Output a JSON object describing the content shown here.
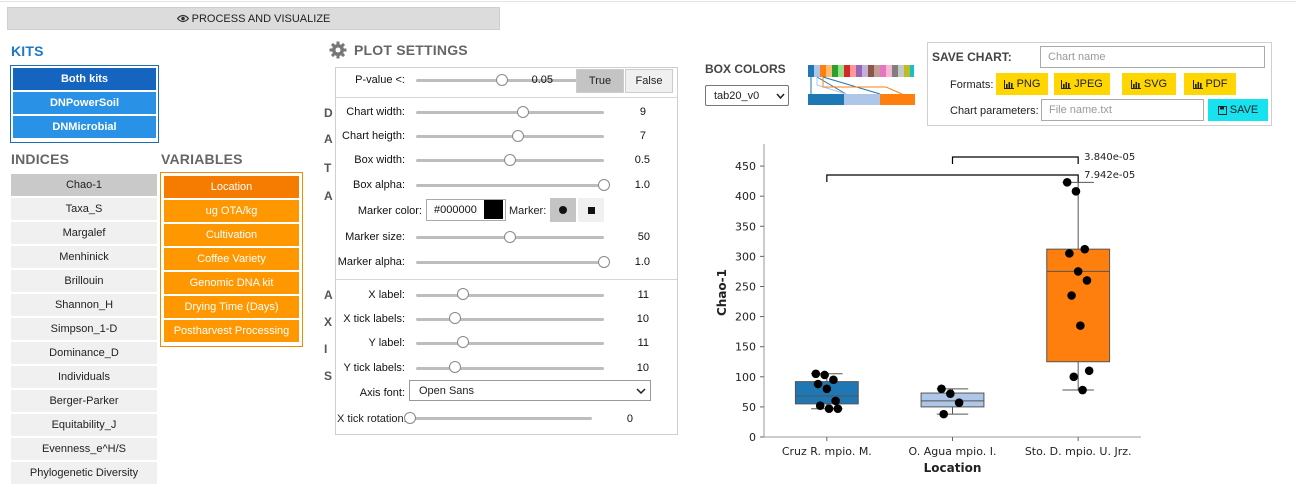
{
  "process": {
    "label": "PROCESS AND VISUALIZE",
    "icon": "eye-icon"
  },
  "kits": {
    "title": "KITS",
    "items": [
      "Both kits",
      "DNPowerSoil",
      "DNMicrobial"
    ],
    "active_index": 0
  },
  "indices": {
    "title": "INDICES",
    "items": [
      "Chao-1",
      "Taxa_S",
      "Margalef",
      "Menhinick",
      "Brillouin",
      "Shannon_H",
      "Simpson_1-D",
      "Dominance_D",
      "Individuals",
      "Berger-Parker",
      "Equitability_J",
      "Evenness_e^H/S",
      "Phylogenetic Diversity"
    ],
    "active_index": 0
  },
  "variables": {
    "title": "VARIABLES",
    "items": [
      "Location",
      "ug OTA/kg",
      "Cultivation",
      "Coffee Variety",
      "Genomic DNA kit",
      "Drying Time (Days)",
      "Postharvest Processing"
    ],
    "active_index": 0
  },
  "plot_settings": {
    "title": "PLOT SETTINGS",
    "icon": "gear-icon",
    "pvalue": {
      "label": "P-value <:",
      "value": "0.05",
      "fraction": 0.46
    },
    "true_label": "True",
    "false_label": "False",
    "data_letters": [
      "D",
      "A",
      "T",
      "A"
    ],
    "axis_letters": [
      "A",
      "X",
      "I",
      "S"
    ],
    "data_rows": [
      {
        "label": "Chart width:",
        "value": "9",
        "fraction": 0.57
      },
      {
        "label": "Chart heigth:",
        "value": "7",
        "fraction": 0.54
      },
      {
        "label": "Box width:",
        "value": "0.5",
        "fraction": 0.5
      },
      {
        "label": "Box alpha:",
        "value": "1.0",
        "fraction": 1.0
      }
    ],
    "marker_color_label": "Marker color:",
    "marker_color_value": "#000000",
    "marker_label": "Marker:",
    "marker_rows": [
      {
        "label": "Marker size:",
        "value": "50",
        "fraction": 0.5
      },
      {
        "label": "Marker alpha:",
        "value": "1.0",
        "fraction": 1.0
      }
    ],
    "axis_rows": [
      {
        "label": "X label:",
        "value": "11",
        "fraction": 0.25
      },
      {
        "label": "X tick labels:",
        "value": "10",
        "fraction": 0.21
      },
      {
        "label": "Y label:",
        "value": "11",
        "fraction": 0.25
      },
      {
        "label": "Y tick labels:",
        "value": "10",
        "fraction": 0.21
      }
    ],
    "axis_font_label": "Axis font:",
    "axis_font_value": "Open Sans",
    "rotation": {
      "label": "X tick rotation:",
      "value": "0",
      "fraction": 0.0
    }
  },
  "box_colors": {
    "title": "BOX COLORS",
    "selected": "tab20_v0"
  },
  "save_chart": {
    "title": "SAVE CHART:",
    "name_placeholder": "Chart name",
    "formats_label": "Formats:",
    "formats": [
      "PNG",
      "JPEG",
      "SVG",
      "PDF"
    ],
    "params_label": "Chart parameters:",
    "file_placeholder": "File name.txt",
    "save_label": "SAVE"
  },
  "colors": {
    "box1": "#1f77b4",
    "box2": "#aec7e8",
    "box3": "#ff7f0e",
    "orange": "#ff9800",
    "blue": "#2a92e6",
    "yellow": "#ffd600",
    "cyan": "#17e3f0"
  },
  "chart_data": {
    "type": "box",
    "xlabel": "Location",
    "ylabel": "Chao-1",
    "ylim": [
      0,
      480
    ],
    "yticks": [
      0,
      50,
      100,
      150,
      200,
      250,
      300,
      350,
      400,
      450
    ],
    "categories": [
      "Cruz R. mpio. M.",
      "O. Agua mpio. I.",
      "Sto. D. mpio. U. Jrz."
    ],
    "boxes": [
      {
        "q1": 55,
        "median": 68,
        "q3": 92,
        "whisker_low": 47,
        "whisker_high": 105,
        "points": [
          105,
          103,
          95,
          88,
          80,
          60,
          52,
          47,
          47
        ]
      },
      {
        "q1": 50,
        "median": 60,
        "q3": 73,
        "whisker_low": 38,
        "whisker_high": 80,
        "points": [
          80,
          72,
          57,
          38
        ]
      },
      {
        "q1": 125,
        "median": 275,
        "q3": 312,
        "whisker_low": 78,
        "whisker_high": 423,
        "points": [
          423,
          408,
          312,
          305,
          275,
          260,
          235,
          185,
          110,
          100,
          78
        ]
      }
    ],
    "annotations": [
      {
        "from": 1,
        "to": 2,
        "text": "3.840e-05"
      },
      {
        "from": 0,
        "to": 2,
        "text": "7.942e-05"
      }
    ]
  }
}
